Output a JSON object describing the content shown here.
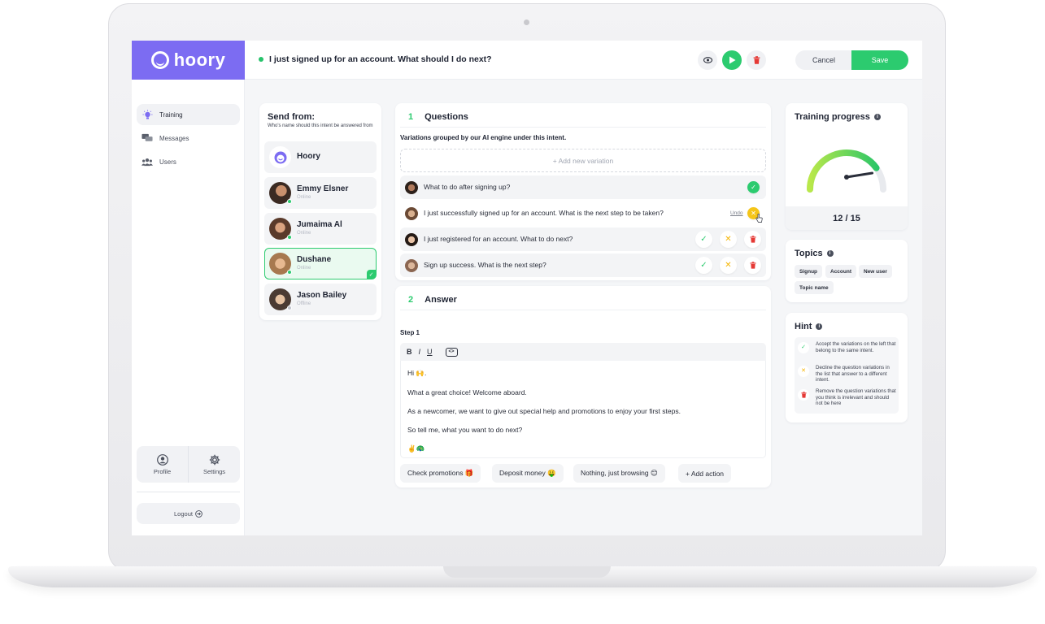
{
  "brand": {
    "name": "hoory",
    "color": "#7c6cf2"
  },
  "topbar": {
    "intent_title": "I just signed up for an account. What should I do next?",
    "preview_icon": "eye-icon",
    "play_icon": "play-icon",
    "delete_icon": "trash-icon",
    "cancel_label": "Cancel",
    "save_label": "Save",
    "accent": "#2ccb6f"
  },
  "nav": {
    "items": [
      {
        "label": "Training",
        "icon": "bulb-icon",
        "active": true
      },
      {
        "label": "Messages",
        "icon": "messages-icon",
        "active": false
      },
      {
        "label": "Users",
        "icon": "users-icon",
        "active": false
      }
    ],
    "profile_label": "Profile",
    "settings_label": "Settings",
    "logout_label": "Logout"
  },
  "send_from": {
    "title": "Send from:",
    "subtitle": "Who's name should this intent be answered from",
    "people": [
      {
        "name": "Hoory",
        "status": ""
      },
      {
        "name": "Emmy Elsner",
        "status": "Online"
      },
      {
        "name": "Jumaima Al",
        "status": "Online"
      },
      {
        "name": "Dushane",
        "status": "Online",
        "selected": true
      },
      {
        "name": "Jason Bailey",
        "status": "Offline"
      }
    ]
  },
  "questions": {
    "number": "1",
    "title": "Questions",
    "subtitle": "Variations grouped by our AI engine under this intent.",
    "add_label": "+ Add new variation",
    "variations": [
      {
        "text": "What to do after signing up?",
        "state": "accepted"
      },
      {
        "text": "I just successfully signed up for an account. What is the next step to be taken?",
        "state": "declined",
        "undo_label": "Undo"
      },
      {
        "text": "I just registered for an account. What to do next?",
        "state": "pending"
      },
      {
        "text": "Sign up success. What is the next step?",
        "state": "pending"
      }
    ]
  },
  "answer": {
    "number": "2",
    "title": "Answer",
    "step_label": "Step 1",
    "toolbar": {
      "bold": "B",
      "italic": "I",
      "underline": "U",
      "code": "<>"
    },
    "lines": [
      "Hi 🙌.",
      "What a great choice! Welcome aboard.",
      "As a newcomer, we want to give out special help and promotions to enjoy your first steps.",
      "So tell me, what you want to do next?",
      "✌️🦚"
    ],
    "actions": [
      "Check promotions 🎁",
      "Deposit money 🤑",
      "Nothing, just browsing 😊",
      "+ Add action"
    ]
  },
  "training_progress": {
    "title": "Training progress",
    "value_label": "12 / 15",
    "current": 12,
    "total": 15
  },
  "topics": {
    "title": "Topics",
    "tags": [
      "Signup",
      "Account",
      "New user",
      "Topic name"
    ]
  },
  "hint": {
    "title": "Hint",
    "items": [
      {
        "icon": "check-icon",
        "text": "Accept the variations on the left that belong to the same intent."
      },
      {
        "icon": "x-icon",
        "text": "Decline the question variations in the list that answer to a different intent."
      },
      {
        "icon": "trash-icon",
        "text": "Remove the question variations that you think is irrelevant and should not be here"
      }
    ]
  }
}
